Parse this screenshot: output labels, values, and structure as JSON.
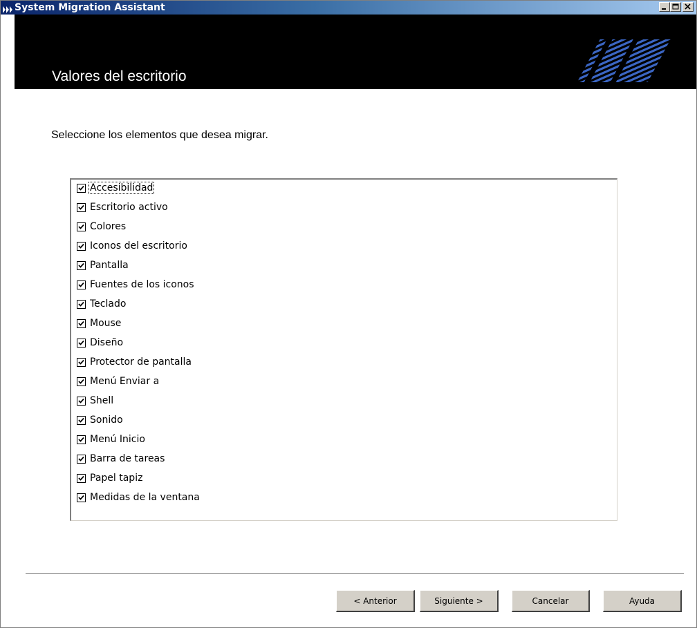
{
  "window": {
    "title": "System Migration Assistant",
    "controls": {
      "minimize": "minimize",
      "maximize": "maximize",
      "close": "close"
    }
  },
  "header": {
    "title": "Valores del escritorio",
    "logo": "IBM"
  },
  "instruction": "Seleccione los elementos que desea migrar.",
  "items": [
    {
      "label": "Accesibilidad",
      "checked": true
    },
    {
      "label": "Escritorio activo",
      "checked": true
    },
    {
      "label": "Colores",
      "checked": true
    },
    {
      "label": "Iconos del escritorio",
      "checked": true
    },
    {
      "label": "Pantalla",
      "checked": true
    },
    {
      "label": "Fuentes de los iconos",
      "checked": true
    },
    {
      "label": "Teclado",
      "checked": true
    },
    {
      "label": "Mouse",
      "checked": true
    },
    {
      "label": "Diseño",
      "checked": true
    },
    {
      "label": "Protector de pantalla",
      "checked": true
    },
    {
      "label": "Menú Enviar a",
      "checked": true
    },
    {
      "label": "Shell",
      "checked": true
    },
    {
      "label": "Sonido",
      "checked": true
    },
    {
      "label": "Menú Inicio",
      "checked": true
    },
    {
      "label": "Barra de tareas",
      "checked": true
    },
    {
      "label": "Papel tapiz",
      "checked": true
    },
    {
      "label": "Medidas de la ventana",
      "checked": true
    }
  ],
  "buttons": {
    "back": "< Anterior",
    "next": "Siguiente >",
    "cancel": "Cancelar",
    "help": "Ayuda"
  }
}
